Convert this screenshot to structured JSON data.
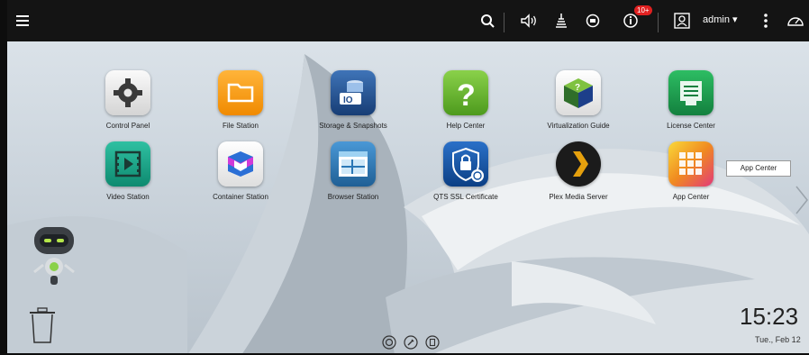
{
  "topbar": {
    "menu_icon": "hamburger-icon",
    "search_icon": "search-icon",
    "volume_icon": "volume-icon",
    "tasks_icon": "background-tasks-icon",
    "sync_icon": "sync-icon",
    "notifications_icon": "notification-icon",
    "notification_badge": "10+",
    "user_icon": "user-icon",
    "username": "admin ▾",
    "more_icon": "more-vertical-icon",
    "dashboard_icon": "dashboard-gauge-icon"
  },
  "apps": [
    {
      "label": "Control Panel",
      "icon": "gear-icon",
      "color": "#e9e9e9"
    },
    {
      "label": "File Station",
      "icon": "folder-icon",
      "color": "#f39a12"
    },
    {
      "label": "Storage & Snapshots",
      "icon": "storage-icon",
      "color": "#1f4a8a"
    },
    {
      "label": "Help Center",
      "icon": "question-icon",
      "color": "#6dbb2f"
    },
    {
      "label": "Virtualization Guide",
      "icon": "cube-icon",
      "color": "#f2f2f2"
    },
    {
      "label": "License Center",
      "icon": "license-icon",
      "color": "#1c9a4d"
    },
    {
      "label": "Video Station",
      "icon": "video-icon",
      "color": "#1aa58a"
    },
    {
      "label": "Container Station",
      "icon": "container-icon",
      "color": "#f4f4f4"
    },
    {
      "label": "Browser Station",
      "icon": "browser-icon",
      "color": "#2a77b5"
    },
    {
      "label": "QTS SSL Certificate",
      "icon": "lock-shield-icon",
      "color": "#1453a0"
    },
    {
      "label": "Plex Media Server",
      "icon": "plex-icon",
      "color": "#1b1b1b"
    },
    {
      "label": "App Center",
      "icon": "app-grid-icon",
      "color": "#f5a623"
    }
  ],
  "tooltip": "App Center",
  "clock": {
    "time": "15:23",
    "date": "Tue., Feb 12"
  },
  "dock": {
    "items": [
      "myqnapcloud-icon",
      "tools-icon",
      "mobile-icon"
    ]
  },
  "next_page_icon": "chevron-right-icon",
  "recycle_bin_icon": "trash-icon",
  "assistant_icon": "robot-assistant-icon"
}
